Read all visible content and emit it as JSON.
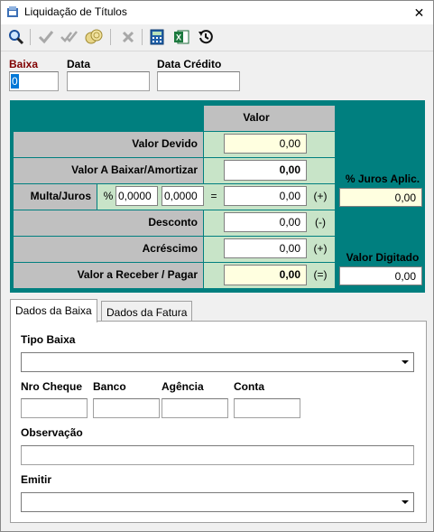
{
  "window": {
    "title": "Liquidação de Títulos",
    "close_glyph": "✕"
  },
  "toolbar": {
    "icons": [
      "search-icon",
      "check-icon",
      "double-check-icon",
      "coins-icon",
      "cancel-icon",
      "calculator-icon",
      "excel-icon",
      "history-icon"
    ]
  },
  "header": {
    "baixa_label": "Baixa",
    "baixa_value": "0",
    "data_label": "Data",
    "data_value": "",
    "data_credito_label": "Data Crédito",
    "data_credito_value": ""
  },
  "panel": {
    "valor_header": "Valor",
    "valor_devido_label": "Valor Devido",
    "valor_devido_value": "0,00",
    "valor_baixar_label": "Valor A Baixar/Amortizar",
    "valor_baixar_value": "0,00",
    "multa_juros_label": "Multa/Juros",
    "percent_sign": "%",
    "multa_pct": "0,0000",
    "juros_pct": "0,0000",
    "equals_sign": "=",
    "multa_juros_value": "0,00",
    "multa_juros_sign": "(+)",
    "desconto_label": "Desconto",
    "desconto_value": "0,00",
    "desconto_sign": "(-)",
    "acrescimo_label": "Acréscimo",
    "acrescimo_value": "0,00",
    "acrescimo_sign": "(+)",
    "valor_receber_label": "Valor a Receber / Pagar",
    "valor_receber_value": "0,00",
    "valor_receber_sign": "(=)",
    "juros_aplic_label": "% Juros Aplic.",
    "juros_aplic_value": "0,00",
    "valor_digitado_label": "Valor Digitado",
    "valor_digitado_value": "0,00"
  },
  "tabs": {
    "dados_baixa": "Dados da Baixa",
    "dados_fatura": "Dados da Fatura"
  },
  "form": {
    "tipo_baixa_label": "Tipo Baixa",
    "tipo_baixa_value": "",
    "nro_cheque_label": "Nro Cheque",
    "banco_label": "Banco",
    "agencia_label": "Agência",
    "conta_label": "Conta",
    "observacao_label": "Observação",
    "emitir_label": "Emitir",
    "emitir_value": ""
  }
}
